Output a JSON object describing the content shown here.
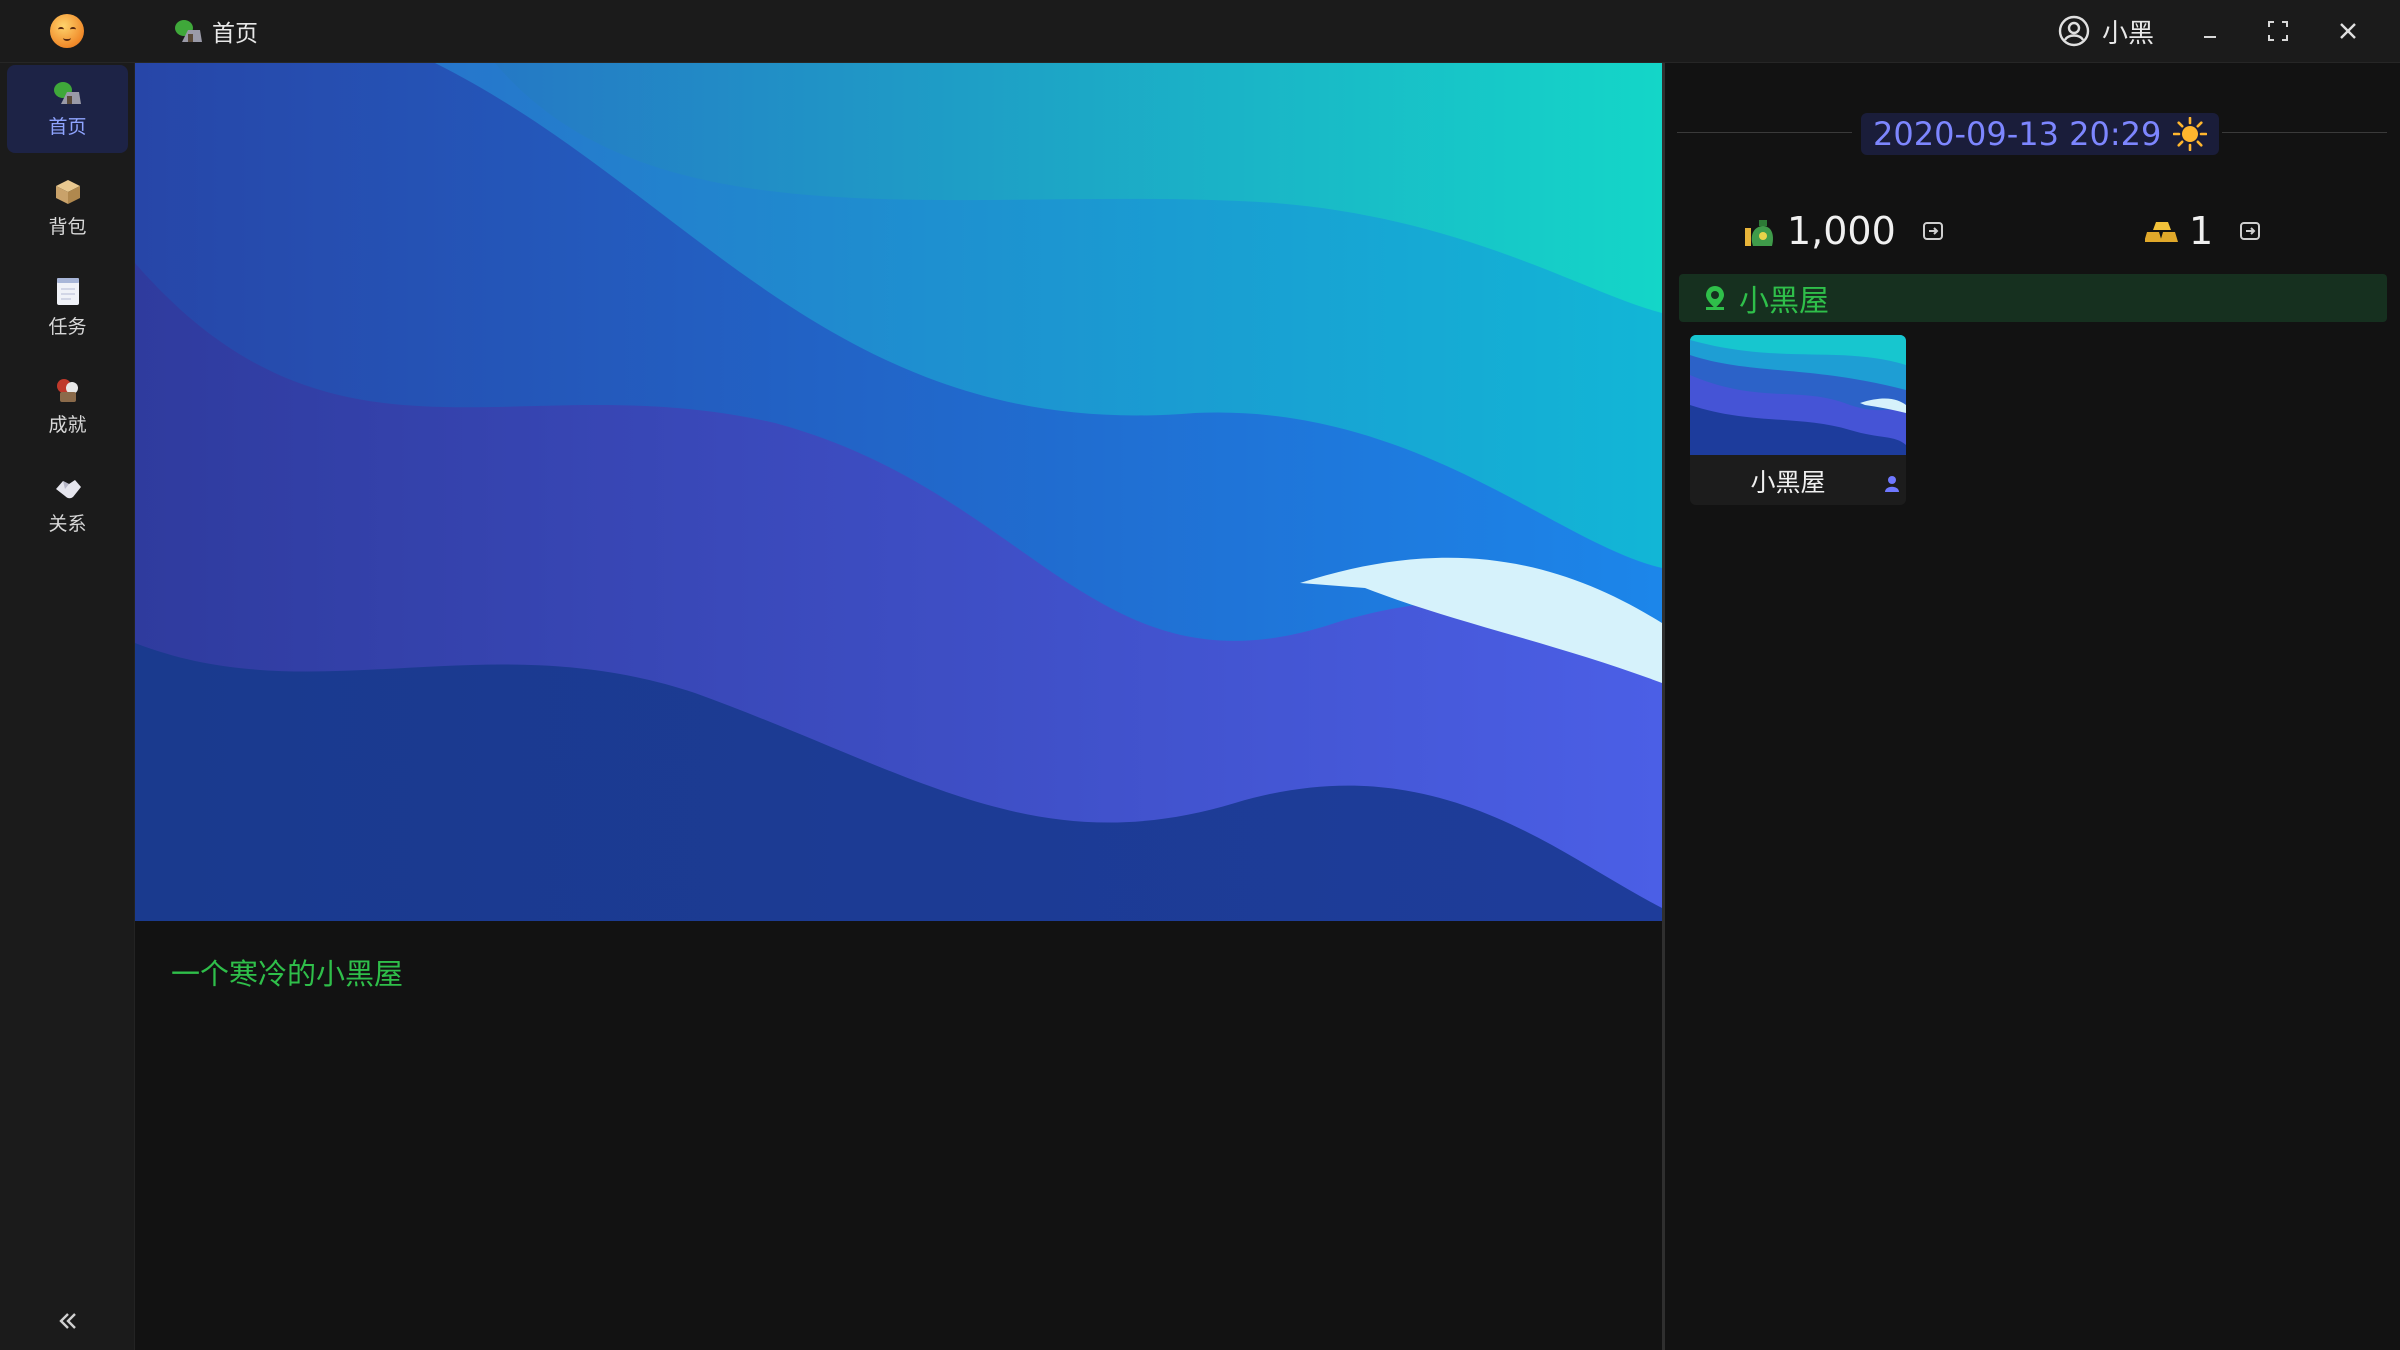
{
  "titlebar": {
    "tab_home_label": "首页",
    "user_name": "小黑"
  },
  "sidebar": {
    "items": [
      {
        "label": "首页",
        "icon": "home-icon",
        "active": true
      },
      {
        "label": "背包",
        "icon": "box-icon",
        "active": false
      },
      {
        "label": "任务",
        "icon": "notepad-icon",
        "active": false
      },
      {
        "label": "成就",
        "icon": "trophy-icon",
        "active": false
      },
      {
        "label": "关系",
        "icon": "handshake-icon",
        "active": false
      }
    ]
  },
  "main": {
    "description": "一个寒冷的小黑屋"
  },
  "panel": {
    "datetime": "2020-09-13 20:29",
    "weather_icon": "sun-icon",
    "money": "1,000",
    "gold": "1",
    "location": "小黑屋",
    "room_card_name": "小黑屋"
  },
  "colors": {
    "accent": "#7d86ff",
    "location_green": "#2fbf4a",
    "background": "#121212"
  }
}
